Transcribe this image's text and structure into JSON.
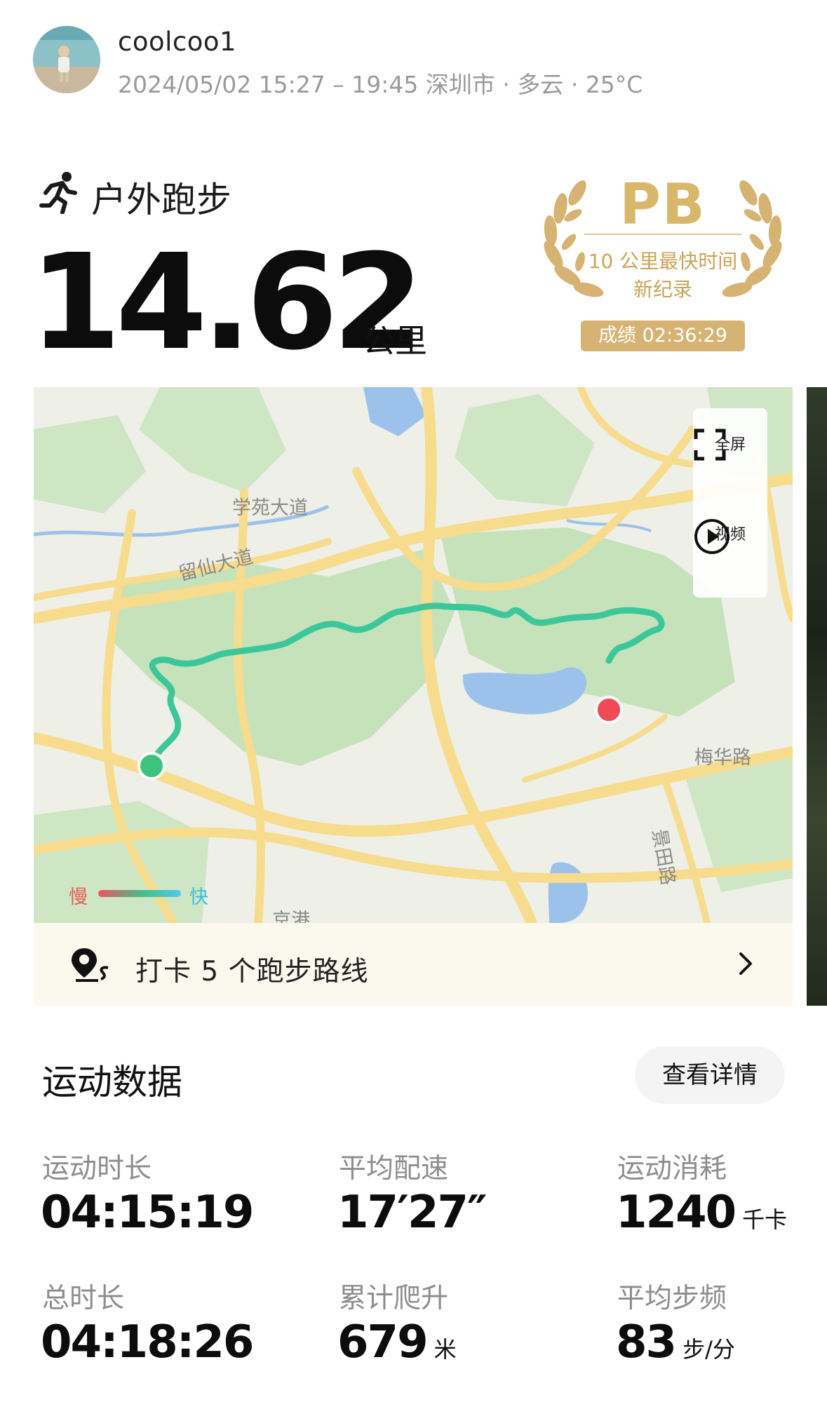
{
  "user": {
    "name": "coolcoo1",
    "meta": "2024/05/02 15:27 – 19:45 深圳市 · 多云 · 25°C"
  },
  "activity": {
    "type": "户外跑步",
    "distance": "14.62",
    "unit": "公里",
    "icon": "running-icon"
  },
  "pb": {
    "title": "PB",
    "line1": "10 公里最快时间",
    "line2": "新纪录",
    "result": "成绩 02:36:29",
    "color": "#d6b373"
  },
  "map": {
    "labels": {
      "road1": "学苑大道",
      "road2": "留仙大道",
      "road3": "梅华路",
      "road4": "景田路",
      "road5": "京港"
    },
    "controls": {
      "fullscreen": "全屏",
      "video": "视频"
    },
    "legend": {
      "slow": "慢",
      "fast": "快"
    },
    "route_color": "#3cc79a",
    "start_color": "#3cc47e",
    "end_color": "#ef4a55"
  },
  "checkin": {
    "text": "打卡 5 个跑步路线"
  },
  "stats": {
    "title": "运动数据",
    "details_button": "查看详情",
    "items": [
      {
        "label": "运动时长",
        "value": "04:15:19",
        "unit": ""
      },
      {
        "label": "平均配速",
        "value": "17′27″",
        "unit": ""
      },
      {
        "label": "运动消耗",
        "value": "1240",
        "unit": "千卡"
      },
      {
        "label": "总时长",
        "value": "04:18:26",
        "unit": ""
      },
      {
        "label": "累计爬升",
        "value": "679",
        "unit": "米"
      },
      {
        "label": "平均步频",
        "value": "83",
        "unit": "步/分"
      }
    ]
  }
}
